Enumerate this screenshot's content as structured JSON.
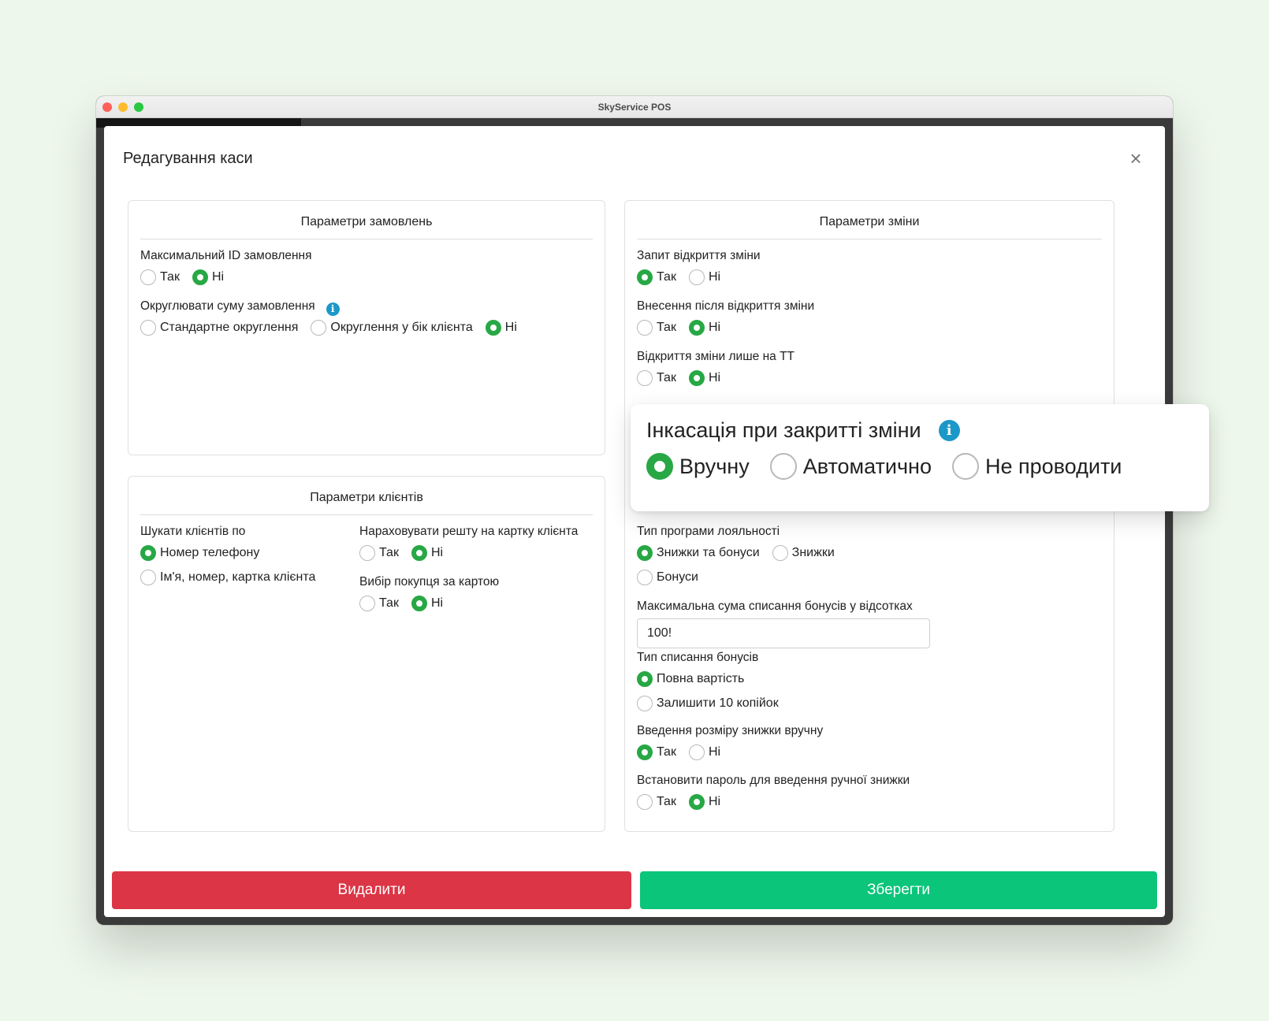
{
  "window": {
    "title": "SkyService POS"
  },
  "dialog": {
    "title": "Редагування каси",
    "close_icon": "close-icon"
  },
  "orders": {
    "title": "Параметри замовлень",
    "max_id": {
      "label": "Максимальний ID замовлення",
      "yes": "Так",
      "no": "Ні",
      "selected": "no"
    },
    "rounding": {
      "label": "Округлювати суму замовлення",
      "standard": "Стандартне округлення",
      "client": "Округлення у бік клієнта",
      "no": "Ні",
      "selected": "no"
    }
  },
  "clients": {
    "title": "Параметри клієнтів",
    "search": {
      "label": "Шукати клієнтів по",
      "phone": "Номер телефону",
      "any": "Ім'я, номер, картка клієнта",
      "selected": "phone"
    },
    "change": {
      "label": "Нараховувати решту на картку клієнта",
      "yes": "Так",
      "no": "Ні",
      "selected": "no"
    },
    "buyer": {
      "label": "Вибір покупця за картою",
      "yes": "Так",
      "no": "Ні",
      "selected": "no"
    }
  },
  "shift": {
    "title": "Параметри зміни",
    "open_request": {
      "label": "Запит відкриття зміни",
      "yes": "Так",
      "no": "Ні",
      "selected": "yes"
    },
    "deposit_after": {
      "label": "Внесення після відкриття зміни",
      "yes": "Так",
      "no": "Ні",
      "selected": "no"
    },
    "open_tt": {
      "label": "Відкриття зміни лише на ТТ",
      "yes": "Так",
      "no": "Ні",
      "selected": "no"
    }
  },
  "collection_zoom": {
    "label": "Інкасація при закритті зміни",
    "manual": "Вручну",
    "auto": "Автоматично",
    "none": "Не проводити",
    "selected": "manual"
  },
  "loyalty": {
    "type": {
      "label": "Тип програми лояльності",
      "both": "Знижки та бонуси",
      "discounts": "Знижки",
      "bonuses": "Бонуси",
      "selected": "both"
    },
    "max_bonus": {
      "label": "Максимальна сума списання бонусів у відсотках",
      "value": "100!"
    },
    "writeoff": {
      "label": "Тип списання бонусів",
      "full": "Повна вартість",
      "keep": "Залишити 10 копійок",
      "selected": "full"
    },
    "manual_discount": {
      "label": "Введення розміру знижки вручну",
      "yes": "Так",
      "no": "Ні",
      "selected": "yes"
    },
    "password": {
      "label": "Встановити пароль для введення ручної знижки",
      "yes": "Так",
      "no": "Ні",
      "selected": "no"
    }
  },
  "buttons": {
    "delete": "Видалити",
    "save": "Зберегти"
  },
  "colors": {
    "accent_green": "#27a845",
    "delete_red": "#dc3545",
    "save_green": "#0bc57a",
    "info_blue": "#1c98c8"
  }
}
